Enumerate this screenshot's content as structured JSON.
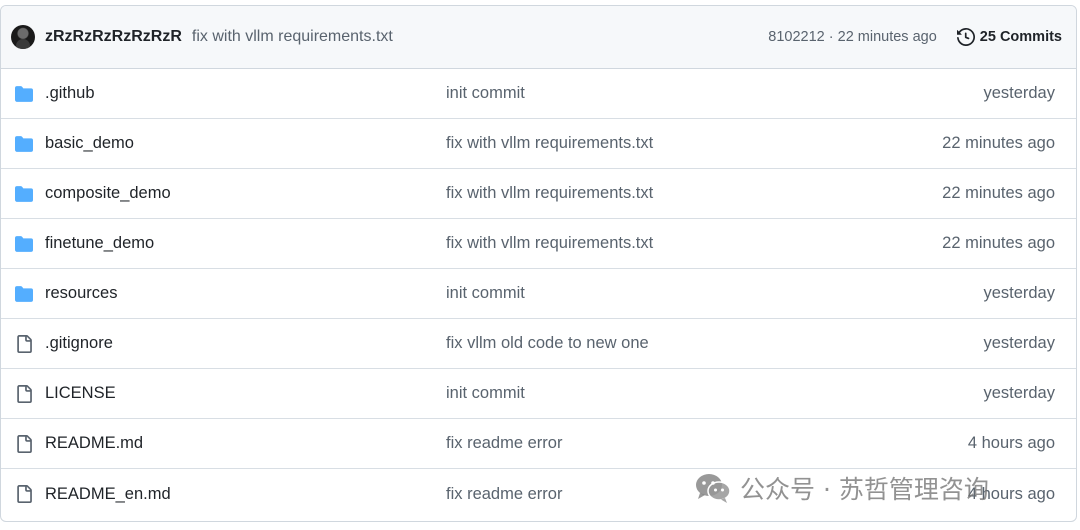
{
  "latest_commit": {
    "author": "zRzRzRzRzRzRzR",
    "message": "fix with vllm requirements.txt",
    "hash_time": "8102212 · 22 minutes ago",
    "commits_label": "25 Commits"
  },
  "files": [
    {
      "type": "folder",
      "name": ".github",
      "message": "init commit",
      "time": "yesterday"
    },
    {
      "type": "folder",
      "name": "basic_demo",
      "message": "fix with vllm requirements.txt",
      "time": "22 minutes ago"
    },
    {
      "type": "folder",
      "name": "composite_demo",
      "message": "fix with vllm requirements.txt",
      "time": "22 minutes ago"
    },
    {
      "type": "folder",
      "name": "finetune_demo",
      "message": "fix with vllm requirements.txt",
      "time": "22 minutes ago"
    },
    {
      "type": "folder",
      "name": "resources",
      "message": "init commit",
      "time": "yesterday"
    },
    {
      "type": "file",
      "name": ".gitignore",
      "message": "fix vllm old code to new one",
      "time": "yesterday"
    },
    {
      "type": "file",
      "name": "LICENSE",
      "message": "init commit",
      "time": "yesterday"
    },
    {
      "type": "file",
      "name": "README.md",
      "message": "fix readme error",
      "time": "4 hours ago"
    },
    {
      "type": "file",
      "name": "README_en.md",
      "message": "fix readme error",
      "time": "4 hours ago"
    }
  ],
  "icons": {
    "folder": "folder-icon",
    "file": "file-icon",
    "history": "history-icon",
    "wechat": "wechat-icon"
  },
  "colors": {
    "folder": "#54aeff",
    "file_outline": "#59636e",
    "muted_text": "#59636e",
    "border": "#d0d7de"
  },
  "watermark": {
    "text": "公众号 · 苏哲管理咨询"
  }
}
